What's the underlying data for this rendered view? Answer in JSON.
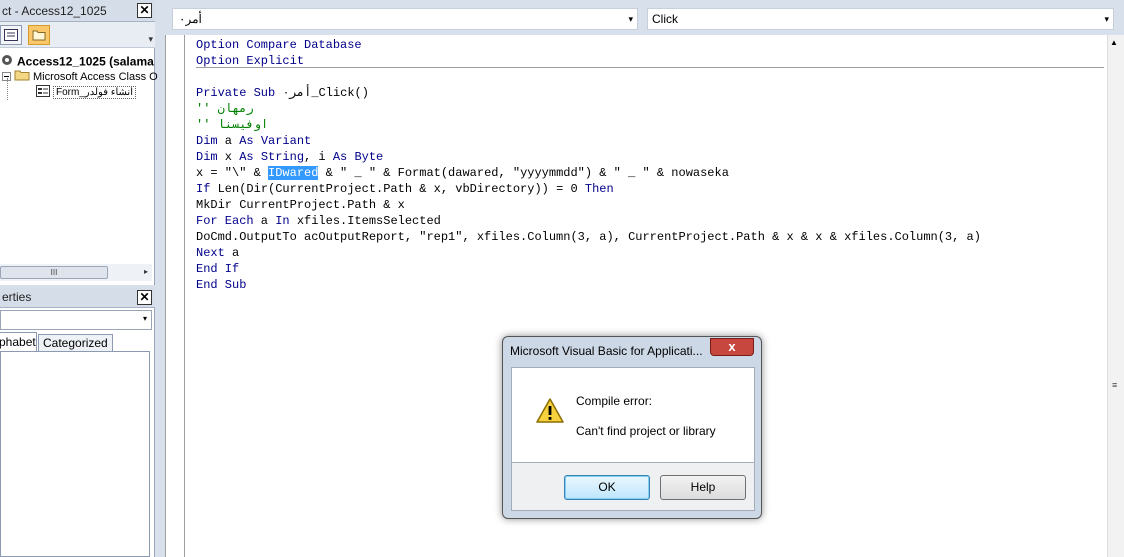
{
  "project_explorer": {
    "title": "ct - Access12_1025",
    "close": "✕",
    "more": "▾",
    "tree": [
      {
        "label": "Access12_1025 (salama",
        "icon": "vba-project-icon"
      },
      {
        "label": "Microsoft Access Class O",
        "icon": "folder-icon"
      },
      {
        "label": "Form_انشاء فولدر",
        "icon": "form-icon"
      }
    ],
    "hscroll_thumb": "III",
    "hscroll_arrow": "▸"
  },
  "properties": {
    "title": "erties",
    "close": "✕",
    "dropdown_arrow": "▾",
    "tabs": [
      "phabetic",
      "Categorized"
    ]
  },
  "combos": {
    "object": "أمر٠",
    "procedure": "Click",
    "arrow": "▾"
  },
  "code": {
    "lines": [
      [
        {
          "t": "Option Compare Database",
          "k": "kw"
        }
      ],
      [
        {
          "t": "Option Explicit",
          "k": "kw"
        }
      ],
      [
        {
          "t": "",
          "k": ""
        }
      ],
      [
        {
          "t": "Private Sub ",
          "k": "kw"
        },
        {
          "t": "أمر٠_Click()",
          "k": ""
        }
      ],
      [
        {
          "t": "'' رمهان",
          "k": "cm"
        }
      ],
      [
        {
          "t": "'' اوفيسنا",
          "k": "cm"
        }
      ],
      [
        {
          "t": "Dim",
          "k": "kw"
        },
        {
          "t": " a ",
          "k": ""
        },
        {
          "t": "As Variant",
          "k": "kw"
        }
      ],
      [
        {
          "t": "Dim",
          "k": "kw"
        },
        {
          "t": " x ",
          "k": ""
        },
        {
          "t": "As String",
          "k": "kw"
        },
        {
          "t": ", i ",
          "k": ""
        },
        {
          "t": "As Byte",
          "k": "kw"
        }
      ],
      [
        {
          "t": "x = \"\\\" & ",
          "k": ""
        },
        {
          "t": "IDwared",
          "k": "sel"
        },
        {
          "t": " & \" _ \" & Format(dawared, \"yyyymmdd\") & \" _ \" & nowaseka",
          "k": ""
        }
      ],
      [
        {
          "t": "If",
          "k": "kw"
        },
        {
          "t": " Len(Dir(CurrentProject.Path & x, vbDirectory)) = 0 ",
          "k": ""
        },
        {
          "t": "Then",
          "k": "kw"
        }
      ],
      [
        {
          "t": "MkDir CurrentProject.Path & x",
          "k": ""
        }
      ],
      [
        {
          "t": "For Each",
          "k": "kw"
        },
        {
          "t": " a ",
          "k": ""
        },
        {
          "t": "In",
          "k": "kw"
        },
        {
          "t": " xfiles.ItemsSelected",
          "k": ""
        }
      ],
      [
        {
          "t": "DoCmd.OutputTo acOutputReport, \"rep1\", xfiles.Column(3, a), CurrentProject.Path & x & x & xfiles.Column(3, a)",
          "k": ""
        }
      ],
      [
        {
          "t": "Next",
          "k": "kw"
        },
        {
          "t": " a",
          "k": ""
        }
      ],
      [
        {
          "t": "End If",
          "k": "kw"
        }
      ],
      [
        {
          "t": "End Sub",
          "k": "kw"
        }
      ]
    ]
  },
  "dialog": {
    "title": "Microsoft Visual Basic for Applicati...",
    "close": "x",
    "message_title": "Compile error:",
    "message_body": "Can't find project or library",
    "ok_label": "OK",
    "help_label": "Help"
  },
  "colors": {
    "keyword": "#00008b",
    "comment": "#008000",
    "selection": "#3399ff",
    "dialog_close": "#c7463e"
  }
}
